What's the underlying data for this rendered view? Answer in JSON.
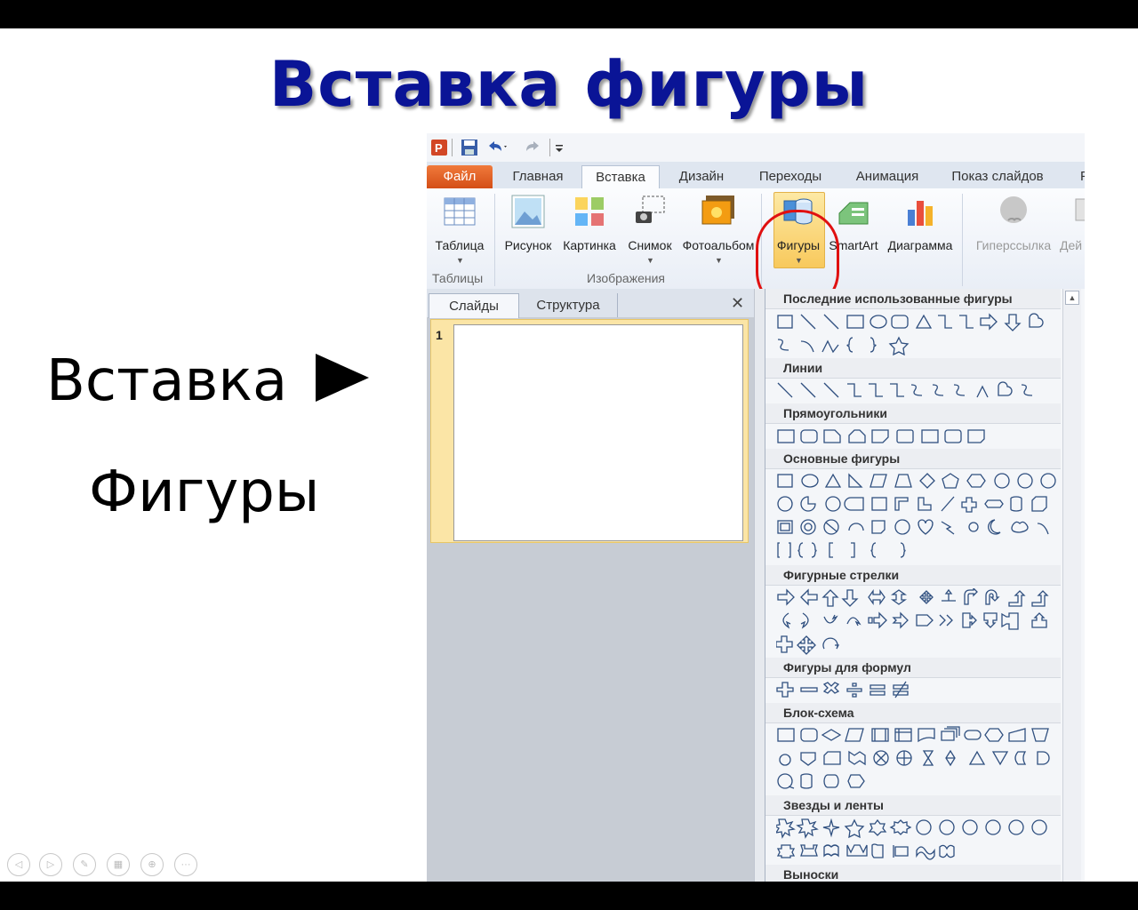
{
  "slide": {
    "title": "Вставка фигуры",
    "bullet1": "Вставка",
    "bullet2": "Фигуры"
  },
  "powerpoint": {
    "tabs": [
      {
        "label": "Файл"
      },
      {
        "label": "Главная"
      },
      {
        "label": "Вставка"
      },
      {
        "label": "Дизайн"
      },
      {
        "label": "Переходы"
      },
      {
        "label": "Анимация"
      },
      {
        "label": "Показ слайдов"
      },
      {
        "label": "Р"
      }
    ],
    "ribbon": {
      "table": "Таблица",
      "picture": "Рисунок",
      "clipart": "Картинка",
      "screenshot": "Снимок",
      "photoalbum": "Фотоальбом",
      "shapes": "Фигуры",
      "smartart": "SmartArt",
      "chart": "Диаграмма",
      "hyperlink": "Гиперссылка",
      "action": "Дей",
      "group_tables": "Таблицы",
      "group_images": "Изображения"
    },
    "pane": {
      "tab_slides": "Слайды",
      "tab_outline": "Структура",
      "slide_number": "1"
    },
    "gallery": {
      "sections": [
        {
          "title": "Последние использованные фигуры"
        },
        {
          "title": "Линии"
        },
        {
          "title": "Прямоугольники"
        },
        {
          "title": "Основные фигуры"
        },
        {
          "title": "Фигурные стрелки"
        },
        {
          "title": "Фигуры для формул"
        },
        {
          "title": "Блок-схема"
        },
        {
          "title": "Звезды и ленты"
        },
        {
          "title": "Выноски"
        }
      ]
    }
  },
  "colors": {
    "title": "#0a1496",
    "file_tab": "#e35c1f",
    "highlight": "#f8c95c",
    "callout_circle": "#e01010"
  },
  "icons": [
    "powerpoint-logo-icon",
    "save-icon",
    "undo-icon",
    "redo-icon",
    "table-icon",
    "picture-icon",
    "clipart-icon",
    "screenshot-icon",
    "photoalbum-icon",
    "shapes-icon",
    "smartart-icon",
    "chart-icon",
    "hyperlink-icon",
    "navigation-icons"
  ]
}
